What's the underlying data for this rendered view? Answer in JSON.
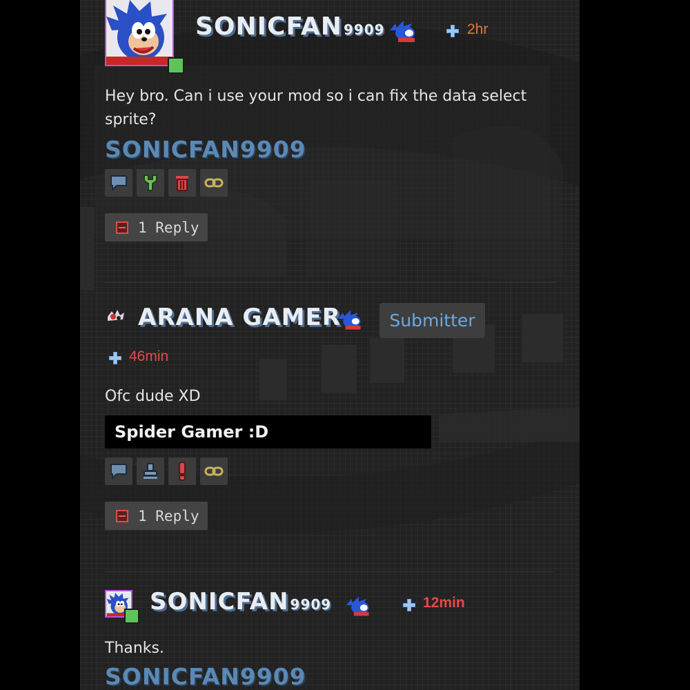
{
  "colors": {
    "background": "#222222",
    "time_orange": "#e0783c",
    "time_red": "#e7494a",
    "signature_blue": "#5a89b6",
    "submitter_text": "#6ea8dc",
    "online_dot": "#5ec45a"
  },
  "comments": [
    {
      "username": "SONICFAN",
      "username_suffix": "9909",
      "time": "2hr",
      "body": "Hey bro. Can i use your mod so i can fix the data select sprite?",
      "signature": "SONICFAN9909",
      "tools": [
        "speech-bubble-icon",
        "wrench-icon",
        "trash-icon",
        "link-icon"
      ],
      "reply_label": "1 Reply"
    },
    {
      "username": "ARANA GAMER",
      "badge": "Submitter",
      "time": "46min",
      "body": "Ofc dude XD",
      "signature": "Spider Gamer :D",
      "tools": [
        "speech-bubble-icon",
        "stamp-icon",
        "exclamation-icon",
        "link-icon"
      ],
      "reply_label": "1 Reply"
    },
    {
      "username": "SONICFAN",
      "username_suffix": "9909",
      "time": "12min",
      "body": "Thanks.",
      "signature": "SONICFAN9909"
    }
  ]
}
